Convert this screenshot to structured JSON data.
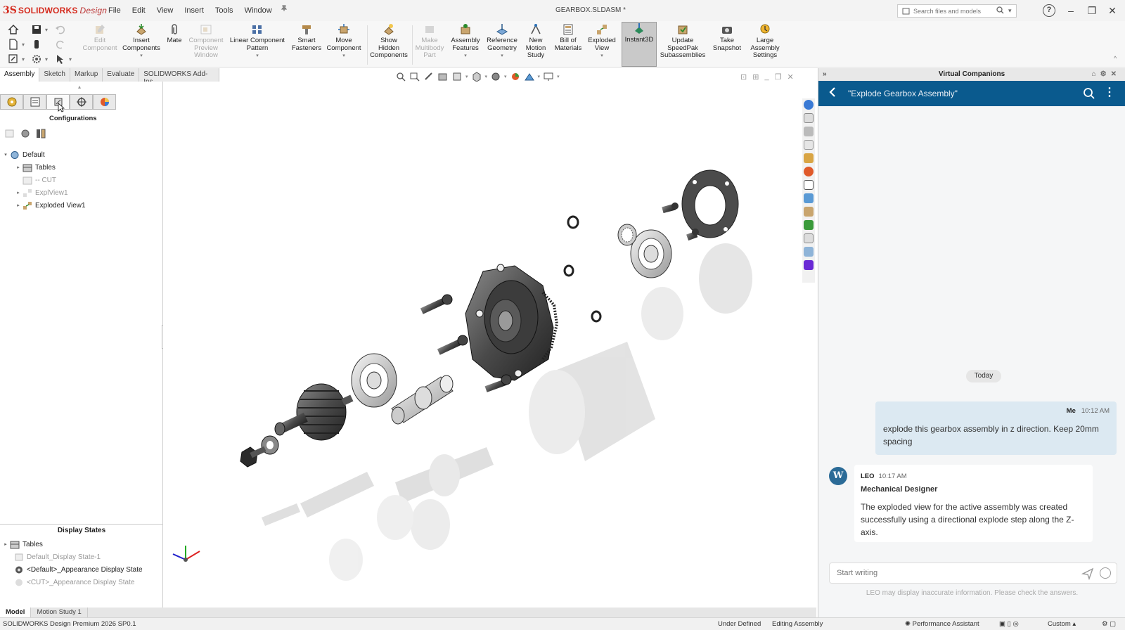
{
  "app": {
    "logo_mark": "3S",
    "brand": "SOLIDWORKS",
    "brand_suffix": "Design",
    "doc_title": "GEARBOX.SLDASM *",
    "menus": [
      "File",
      "Edit",
      "View",
      "Insert",
      "Tools",
      "Window"
    ],
    "search_placeholder": "Search files and models",
    "help_label": "?"
  },
  "ribbon": {
    "buttons": [
      {
        "label": "Edit Component",
        "enabled": false
      },
      {
        "label": "Insert Components",
        "enabled": true
      },
      {
        "label": "Mate",
        "enabled": true
      },
      {
        "label": "Component Preview Window",
        "enabled": false
      },
      {
        "label": "Linear Component Pattern",
        "enabled": true
      },
      {
        "label": "Smart Fasteners",
        "enabled": true
      },
      {
        "label": "Move Component",
        "enabled": true
      },
      {
        "label": "Show Hidden Components",
        "enabled": true
      },
      {
        "label": "Make Multibody Part",
        "enabled": false
      },
      {
        "label": "Assembly Features",
        "enabled": true
      },
      {
        "label": "Reference Geometry",
        "enabled": true
      },
      {
        "label": "New Motion Study",
        "enabled": true
      },
      {
        "label": "Bill of Materials",
        "enabled": true
      },
      {
        "label": "Exploded View",
        "enabled": true
      },
      {
        "label": "Instant3D",
        "enabled": true,
        "active": true
      },
      {
        "label": "Update SpeedPak Subassemblies",
        "enabled": true
      },
      {
        "label": "Take Snapshot",
        "enabled": true
      },
      {
        "label": "Large Assembly Settings",
        "enabled": true
      }
    ]
  },
  "command_tabs": [
    "Assembly",
    "Sketch",
    "Markup",
    "Evaluate",
    "SOLIDWORKS Add-Ins"
  ],
  "left_panel": {
    "panel_tooltip": "Configurations",
    "tree": [
      {
        "label": "Default",
        "level": 0,
        "expanded": true,
        "dim": false
      },
      {
        "label": "Tables",
        "level": 1,
        "expanded": false,
        "dim": false
      },
      {
        "label": "-- CUT",
        "level": 1,
        "expanded": null,
        "dim": true
      },
      {
        "label": "ExplView1",
        "level": 1,
        "expanded": false,
        "dim": true
      },
      {
        "label": "Exploded View1",
        "level": 1,
        "expanded": false,
        "dim": false
      }
    ],
    "display_states_title": "Display States",
    "display_states": [
      {
        "label": "Tables",
        "dim": false
      },
      {
        "label": "Default_Display State-1",
        "dim": true
      },
      {
        "label": "<Default>_Appearance Display State",
        "dim": false
      },
      {
        "label": "<CUT>_Appearance Display State",
        "dim": true
      }
    ]
  },
  "bottom_tabs": [
    "Model",
    "Motion Study 1"
  ],
  "status_bar": {
    "product": "SOLIDWORKS Design Premium 2026 SP0.1",
    "state": "Under Defined",
    "mode": "Editing Assembly",
    "assistant": "Performance Assistant",
    "units": "Custom"
  },
  "companion": {
    "panel_title": "Virtual Companions",
    "chat_title": "\"Explode Gearbox Assembly\"",
    "date_divider": "Today",
    "messages": [
      {
        "sender": "Me",
        "time": "10:12 AM",
        "text": "explode this gearbox assembly in z direction. Keep 20mm spacing"
      },
      {
        "sender": "LEO",
        "time": "10:17 AM",
        "role": "Mechanical Designer",
        "text": "The exploded view for the active assembly was created successfully using a directional explode step along the Z-axis."
      }
    ],
    "compose_placeholder": "Start writing",
    "disclaimer": "LEO may display inaccurate information. Please check the answers."
  },
  "colors": {
    "brand_red": "#d52b1e",
    "chat_header": "#0a5a8e",
    "my_bubble": "#dce9f2"
  }
}
